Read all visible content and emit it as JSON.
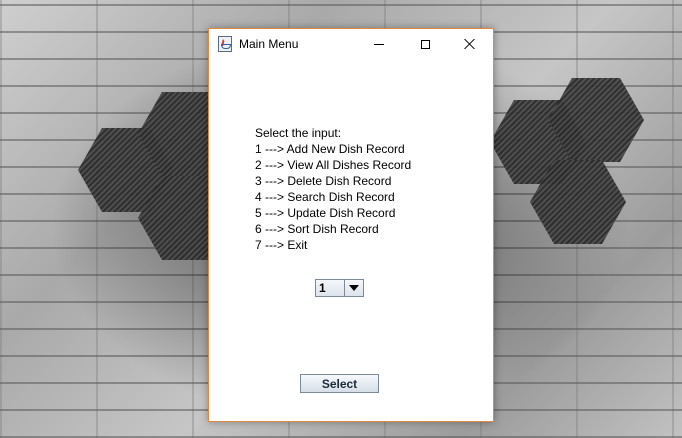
{
  "window": {
    "title": "Main Menu",
    "icon": "java-cup-icon"
  },
  "menu": {
    "prompt": "Select the input:",
    "options": [
      "1 ---> Add New Dish Record",
      "2 ---> View All Dishes Record",
      "3 ---> Delete Dish Record",
      "4 ---> Search Dish Record",
      "5 ---> Update Dish Record",
      "6 ---> Sort Dish Record",
      "7 ---> Exit"
    ]
  },
  "selector": {
    "selected_value": "1"
  },
  "actions": {
    "select_label": "Select"
  },
  "colors": {
    "window_border": "#e4883a",
    "button_text": "#1b2a3a"
  }
}
